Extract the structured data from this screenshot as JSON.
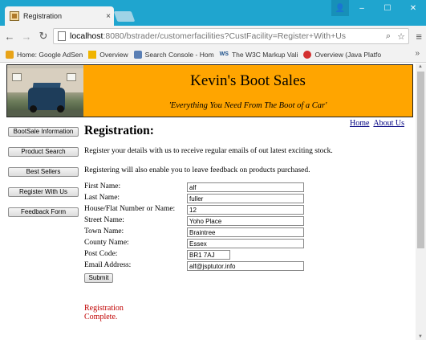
{
  "browser": {
    "tab_title": "Registration",
    "tab_close": "×",
    "window_controls": {
      "minimize": "–",
      "maximize": "☐",
      "close": "✕",
      "user": "👤"
    },
    "url_host": "localhost",
    "url_path": ":8080/bstrader/customerfacilities?CustFacility=Register+With+Us",
    "bookmarks": [
      {
        "label": "Home: Google AdSen",
        "icon_color": "#e8a317"
      },
      {
        "label": "Overview",
        "icon_color": "#f0b400"
      },
      {
        "label": "Search Console - Hom",
        "icon_color": "#5a7fb5"
      },
      {
        "label": "The W3C Markup Vali",
        "icon_color": "#1a4f8a",
        "icon_text": "WS"
      },
      {
        "label": "Overview (Java Platfo",
        "icon_color": "#d32f2f"
      }
    ],
    "bookmarks_more": "»"
  },
  "site": {
    "title": "Kevin's Boot Sales",
    "tagline": "'Everything You Need From The Boot of a Car'",
    "top_links": [
      "Home",
      "About Us"
    ],
    "nav": [
      "BootSale Information",
      "Product Search",
      "Best Sellers",
      "Register With Us",
      "Feedback Form"
    ]
  },
  "page": {
    "heading": "Registration:",
    "intro1": "Register your details with us to receive regular emails of out latest exciting stock.",
    "intro2": "Registering will also enable you to leave feedback on products purchased.",
    "fields": [
      {
        "label": "First Name:",
        "value": "alf"
      },
      {
        "label": "Last Name:",
        "value": "fuller"
      },
      {
        "label": "House/Flat Number or Name:",
        "value": "12"
      },
      {
        "label": "Street Name:",
        "value": "Yoho Place"
      },
      {
        "label": "Town Name:",
        "value": "Braintree"
      },
      {
        "label": "County Name:",
        "value": "Essex"
      },
      {
        "label": "Post Code:",
        "value": "BR1 7AJ"
      },
      {
        "label": "Email Address:",
        "value": "alf@jsptutor.info"
      }
    ],
    "submit_label": "Submit",
    "status": "Registration Complete."
  },
  "colors": {
    "banner": "#ffa500",
    "status": "#c00000",
    "titlebar": "#1fa5cf"
  }
}
